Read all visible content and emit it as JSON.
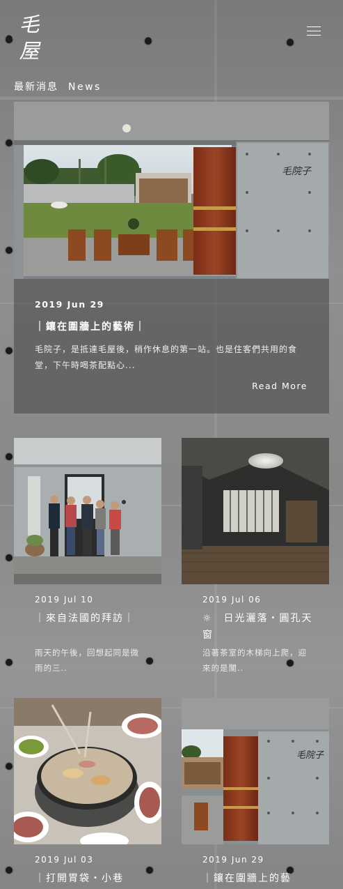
{
  "header": {
    "logo_line1": "毛",
    "logo_line2": "屋",
    "menu_icon": "hamburger-menu-icon",
    "section_title_zh": "最新消息",
    "section_title_en": "News"
  },
  "featured": {
    "date": "2019 Jun 29",
    "title": "｜鑲在圍牆上的藝術｜",
    "excerpt": "毛院子，是抵達毛屋後，稍作休息的第一站。也是住客們共用的食堂，下午時喝茶配點心...",
    "read_more": "Read More",
    "photo_sign": "毛院子"
  },
  "posts": [
    {
      "date": "2019 Jul 10",
      "title": "｜來自法國的拜訪｜",
      "excerpt": "雨天的午後，回想起同是微雨的三.."
    },
    {
      "date": "2019 Jul 06",
      "title": "☼　日光灑落・圓孔天窗",
      "excerpt": "沿著茶室的木梯向上爬，迎來的是闃.."
    },
    {
      "date": "2019 Jul 03",
      "title": "｜打開胃袋・小巷",
      "excerpt": ""
    },
    {
      "date": "2019 Jun 29",
      "title": "｜鑲在圍牆上的藝",
      "excerpt": "",
      "photo_sign": "毛院子"
    }
  ],
  "colors": {
    "concrete": "#8c8c8c",
    "card_overlay": "#464646",
    "text": "#ffffff"
  }
}
